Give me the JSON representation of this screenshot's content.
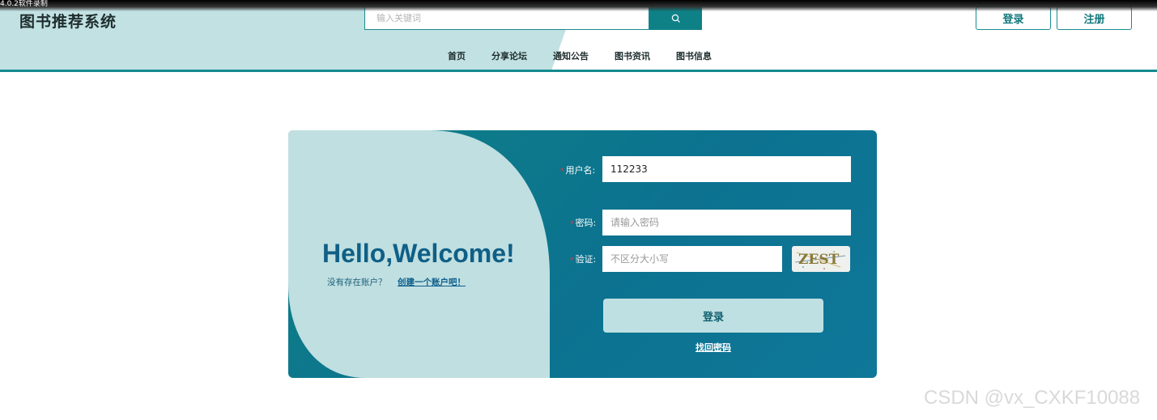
{
  "recording": {
    "label": "4.0.2软件录制"
  },
  "header": {
    "site_title": "图书推荐系统",
    "search": {
      "placeholder": "输入关键词",
      "value": ""
    },
    "login_button": "登录",
    "register_button": "注册",
    "nav": [
      "首页",
      "分享论坛",
      "通知公告",
      "图书资讯",
      "图书信息"
    ]
  },
  "login_card": {
    "welcome_title": "Hello,Welcome!",
    "no_account_text": "没有存在账户？",
    "create_account_link": "创建一个账户吧！",
    "username": {
      "required_mark": "*",
      "label": "用户名:",
      "value": "112233",
      "hint": ""
    },
    "password": {
      "required_mark": "*",
      "label": "密码:",
      "placeholder": "请输入密码",
      "value": ""
    },
    "captcha": {
      "required_mark": "*",
      "label": "验证:",
      "placeholder": "不区分大小写",
      "value": "",
      "image_text": "ZEST"
    },
    "submit_button": "登录",
    "forgot_password_link": "找回密码"
  },
  "colors": {
    "accent": "#138a8f",
    "card_gradient_start": "#0e8086",
    "card_gradient_end": "#0f7799",
    "light_panel": "#c0dfe1",
    "title_color": "#0f5f86"
  },
  "icons": {
    "search": "search-icon"
  },
  "watermark": "CSDN @vx_CXKF10088"
}
